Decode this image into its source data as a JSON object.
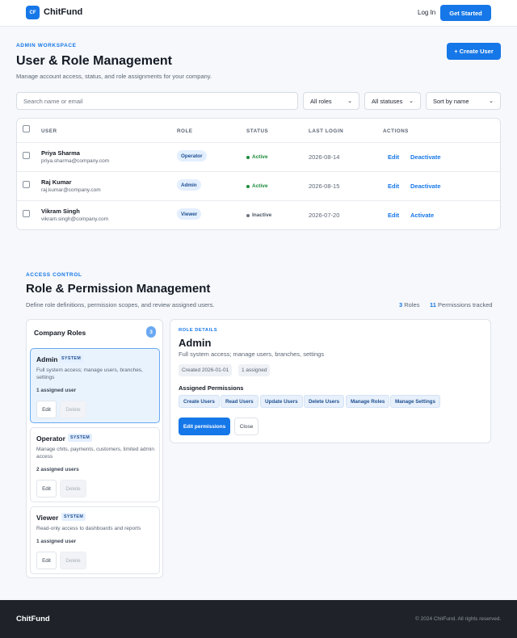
{
  "header": {
    "logo_badge": "CF",
    "brand": "ChitFund",
    "login": "Log In",
    "get_started": "Get Started"
  },
  "users_section": {
    "eyebrow": "ADMIN WORKSPACE",
    "title": "User & Role Management",
    "subtitle": "Manage account access, status, and role assignments for your company.",
    "create_button": "+ Create User",
    "search_placeholder": "Search name or email",
    "filters": {
      "role": "All roles",
      "status": "All statuses",
      "sort": "Sort by name"
    },
    "columns": [
      "USER",
      "ROLE",
      "STATUS",
      "LAST LOGIN",
      "ACTIONS"
    ],
    "rows": [
      {
        "name": "Priya Sharma",
        "email": "priya.sharma@company.com",
        "role": "Operator",
        "status": "Active",
        "last_login": "2026-08-14",
        "edit": "Edit",
        "toggle": "Deactivate"
      },
      {
        "name": "Raj Kumar",
        "email": "raj.kumar@company.com",
        "role": "Admin",
        "status": "Active",
        "last_login": "2026-08-15",
        "edit": "Edit",
        "toggle": "Deactivate"
      },
      {
        "name": "Vikram Singh",
        "email": "vikram.singh@company.com",
        "role": "Viewer",
        "status": "Inactive",
        "last_login": "2026-07-20",
        "edit": "Edit",
        "toggle": "Activate"
      }
    ],
    "status_colors": {
      "Active": "#1a8a3a",
      "Inactive": "#6b7280"
    }
  },
  "roles_section": {
    "eyebrow": "ACCESS CONTROL",
    "title": "Role & Permission Management",
    "subtitle": "Define role definitions, permission scopes, and review assigned users.",
    "roles_count": "3",
    "roles_label": "Roles",
    "permissions_count": "11",
    "permissions_label": "Permissions tracked",
    "panel_title": "Company Roles",
    "panel_count": "3",
    "roles": [
      {
        "name": "Admin",
        "badge": "SYSTEM",
        "description": "Full system access; manage users, branches, settings",
        "assigned": "1 assigned user",
        "edit": "Edit",
        "delete": "Delete"
      },
      {
        "name": "Operator",
        "badge": "SYSTEM",
        "description": "Manage chits, payments, customers, limited admin access",
        "assigned": "2 assigned users",
        "edit": "Edit",
        "delete": "Delete"
      },
      {
        "name": "Viewer",
        "badge": "SYSTEM",
        "description": "Read-only access to dashboards and reports",
        "assigned": "1 assigned user",
        "edit": "Edit",
        "delete": "Delete"
      }
    ],
    "details": {
      "eyebrow": "ROLE DETAILS",
      "title": "Admin",
      "description": "Full system access; manage users, branches, settings",
      "created": "Created 2026-01-01",
      "assigned": "1 assigned",
      "permissions_title": "Assigned Permissions",
      "permissions": [
        "Create Users",
        "Read Users",
        "Update Users",
        "Delete Users",
        "Manage Roles",
        "Manage Settings"
      ],
      "edit_button": "Edit permissions",
      "close_button": "Close"
    }
  },
  "footer": {
    "brand": "ChitFund",
    "copyright": "© 2024 ChitFund. All rights reserved."
  },
  "colors": {
    "accent": "#1677e8",
    "footer_bg": "#1f2329"
  }
}
